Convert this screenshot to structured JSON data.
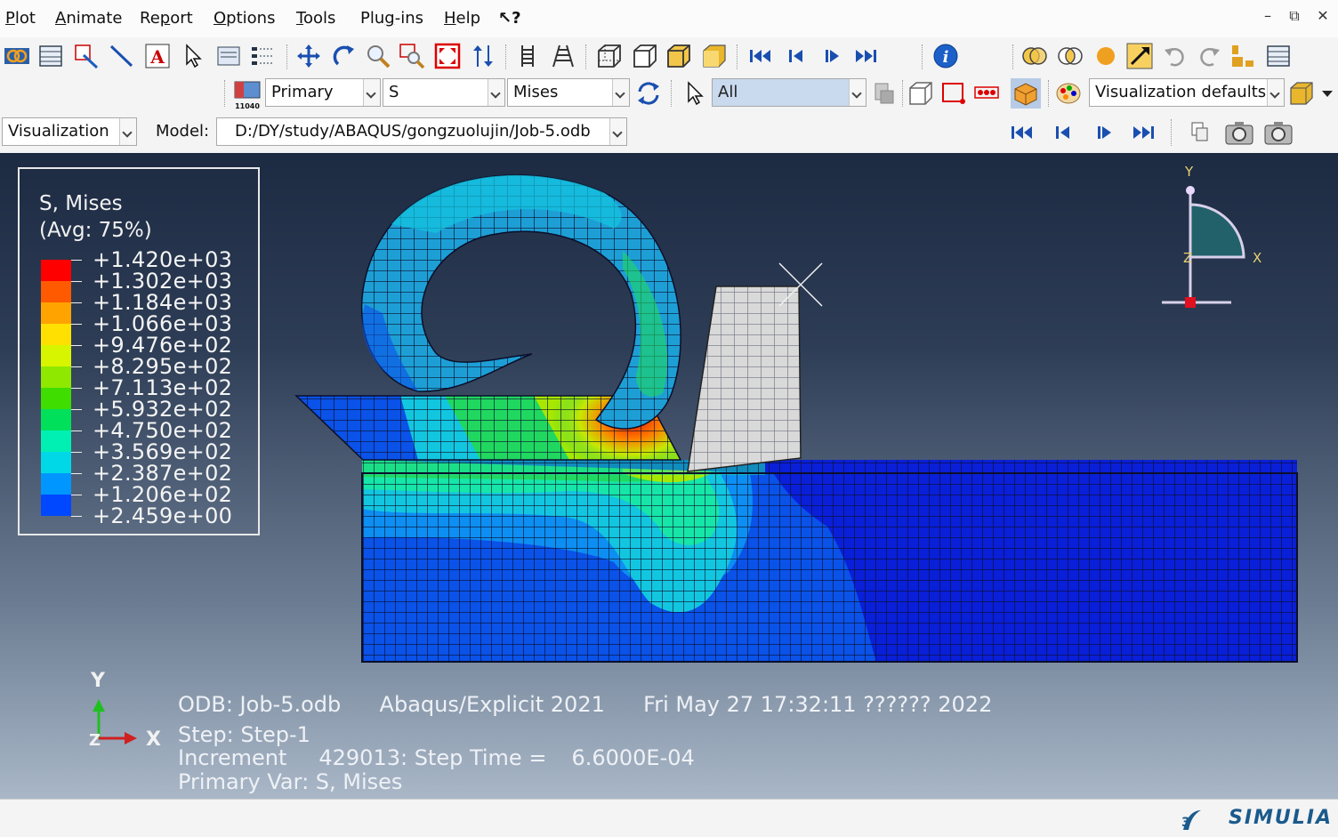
{
  "menu": [
    {
      "u": "P",
      "rest": "lot"
    },
    {
      "u": "A",
      "rest": "nimate"
    },
    {
      "pre": "Re",
      "u": "p",
      "rest": "ort"
    },
    {
      "u": "O",
      "rest": "ptions"
    },
    {
      "u": "T",
      "rest": "ools"
    },
    {
      "pre": "Plu",
      "u": "g",
      "rest": "-ins"
    },
    {
      "u": "H",
      "rest": "elp"
    },
    {
      "pre": "",
      "u": "",
      "rest": "↖?"
    }
  ],
  "toolbar2": {
    "primary": "Primary",
    "variable": "S",
    "invariant": "Mises",
    "selection": "All",
    "visualization_defaults": "Visualization defaults",
    "icon_label": "11040"
  },
  "context": {
    "module": "Visualization",
    "model_label": "Model:",
    "model_path": "D:/DY/study/ABAQUS/gongzuolujin/Job-5.odb"
  },
  "legend": {
    "title": "S, Mises",
    "avg": "(Avg: 75%)",
    "values": [
      "+1.420e+03",
      "+1.302e+03",
      "+1.184e+03",
      "+1.066e+03",
      "+9.476e+02",
      "+8.295e+02",
      "+7.113e+02",
      "+5.932e+02",
      "+4.750e+02",
      "+3.569e+02",
      "+2.387e+02",
      "+1.206e+02",
      "+2.459e+00"
    ],
    "colors": [
      "#ff0000",
      "#ff5a00",
      "#ffa300",
      "#ffe000",
      "#d8f500",
      "#8fe800",
      "#3fdd00",
      "#00e05a",
      "#00f0b4",
      "#00d8e8",
      "#0096ff",
      "#0048ff",
      "#0000f0"
    ]
  },
  "triad": {
    "y": "Y",
    "x": "X",
    "z": "Z"
  },
  "view_triad": {
    "y": "Y",
    "x": "X",
    "z": "Z"
  },
  "info": {
    "line1_a": "ODB: Job-5.odb",
    "line1_b": "Abaqus/Explicit 2021",
    "line1_c": "Fri May 27 17:32:11 ?????? 2022",
    "line2": "Step: Step-1",
    "line3_a": "Increment",
    "line3_b": "429013: Step Time =",
    "line3_c": "6.6000E-04",
    "line4": "Primary Var: S, Mises"
  },
  "brand": "SIMULIA"
}
